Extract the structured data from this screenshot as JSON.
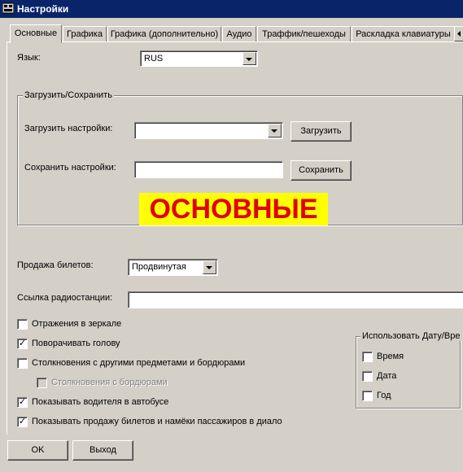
{
  "window": {
    "title": "Настройки"
  },
  "tabs": [
    {
      "label": "Основные"
    },
    {
      "label": "Графика"
    },
    {
      "label": "Графика (дополнительно)"
    },
    {
      "label": "Аудио"
    },
    {
      "label": "Траффик/пешеходы"
    },
    {
      "label": "Раскладка клавиатуры"
    }
  ],
  "language": {
    "label": "Язык:",
    "value": "RUS"
  },
  "load_save": {
    "group_title": "Загрузить/Сохранить",
    "load_label": "Загрузить настройки:",
    "load_value": "",
    "load_button": "Загрузить",
    "save_label": "Сохранить настройки:",
    "save_value": "",
    "save_button": "Сохранить"
  },
  "banner": "ОСНОВНЫЕ",
  "tickets": {
    "label": "Продажа билетов:",
    "value": "Продвинутая"
  },
  "radio": {
    "label": "Ссылка радиостанции:",
    "value": ""
  },
  "checkboxes": [
    {
      "label": "Отражения в зеркале",
      "checked": false
    },
    {
      "label": "Поворачивать голову",
      "checked": true
    },
    {
      "label": "Столкновения с другими предметами и бордюрами",
      "checked": false
    },
    {
      "label": "Столкновения с бордюрами",
      "checked": false,
      "disabled": true
    },
    {
      "label": "Показывать водителя в автобусе",
      "checked": true
    },
    {
      "label": "Показывать продажу билетов и намёки пассажиров в диало",
      "checked": true
    }
  ],
  "datetime": {
    "title": "Использовать Дату/Вре",
    "items": [
      {
        "label": "Время",
        "checked": false
      },
      {
        "label": "Дата",
        "checked": false
      },
      {
        "label": "Год",
        "checked": false
      }
    ]
  },
  "footer": {
    "ok": "OK",
    "exit": "Выход"
  }
}
